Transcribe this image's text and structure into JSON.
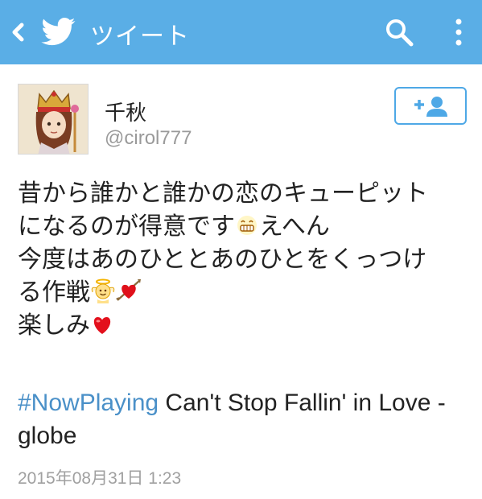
{
  "header": {
    "title": "ツイート",
    "background": "#5aaee6",
    "icons": [
      "back-icon",
      "twitter-bird-icon",
      "search-icon",
      "more-vertical-icon"
    ]
  },
  "user": {
    "display_name": "千秋",
    "username": "@cirol777",
    "follow_icon": "add-user-icon"
  },
  "tweet": {
    "lines": [
      "昔から誰かと誰かの恋のキューピット",
      "になるのが得意です",
      "えへん",
      "今度はあのひととあのひとをくっつけ",
      "る作戦",
      "楽しみ"
    ],
    "emojis": [
      "grin-emoji",
      "angel-emoji",
      "heart-arrow-emoji",
      "red-heart-emoji"
    ],
    "hashtag": "#NowPlaying",
    "now_playing_text": " Can't Stop Fallin' in Love - globe",
    "timestamp": "2015年08月31日 1:23"
  }
}
